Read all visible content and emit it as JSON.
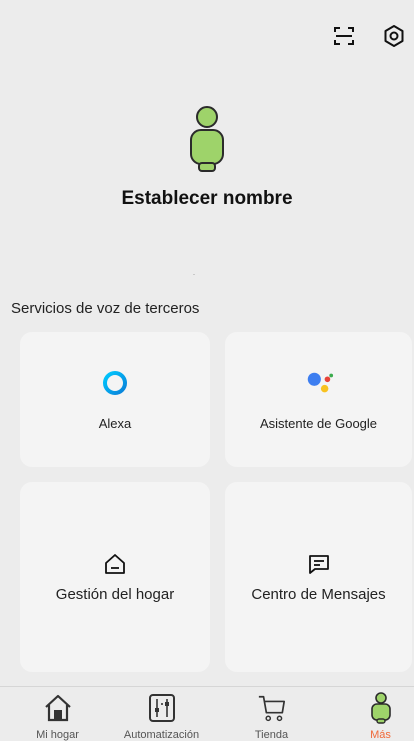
{
  "header": {
    "icons": [
      "scan-icon",
      "settings-icon"
    ]
  },
  "profile": {
    "name": "Establecer nombre"
  },
  "voice_services": {
    "title": "Servicios de voz de terceros",
    "items": [
      {
        "label": "Alexa",
        "icon": "alexa-icon"
      },
      {
        "label": "Asistente de Google",
        "icon": "google-assistant-icon"
      }
    ]
  },
  "cards": [
    {
      "label": "Gestión del hogar",
      "icon": "home-outline-icon"
    },
    {
      "label": "Centro de Mensajes",
      "icon": "message-icon"
    }
  ],
  "nav": {
    "items": [
      {
        "label": "Mi hogar",
        "icon": "home-icon"
      },
      {
        "label": "Automatización",
        "icon": "automation-icon"
      },
      {
        "label": "Tienda",
        "icon": "cart-icon"
      },
      {
        "label": "Más",
        "icon": "profile-icon",
        "active": true
      }
    ],
    "active_color": "#f06a3a"
  },
  "colors": {
    "avatar_fill": "#9ed36a",
    "avatar_stroke": "#2b2b2b",
    "background": "#ececec",
    "card": "#f4f4f4"
  }
}
